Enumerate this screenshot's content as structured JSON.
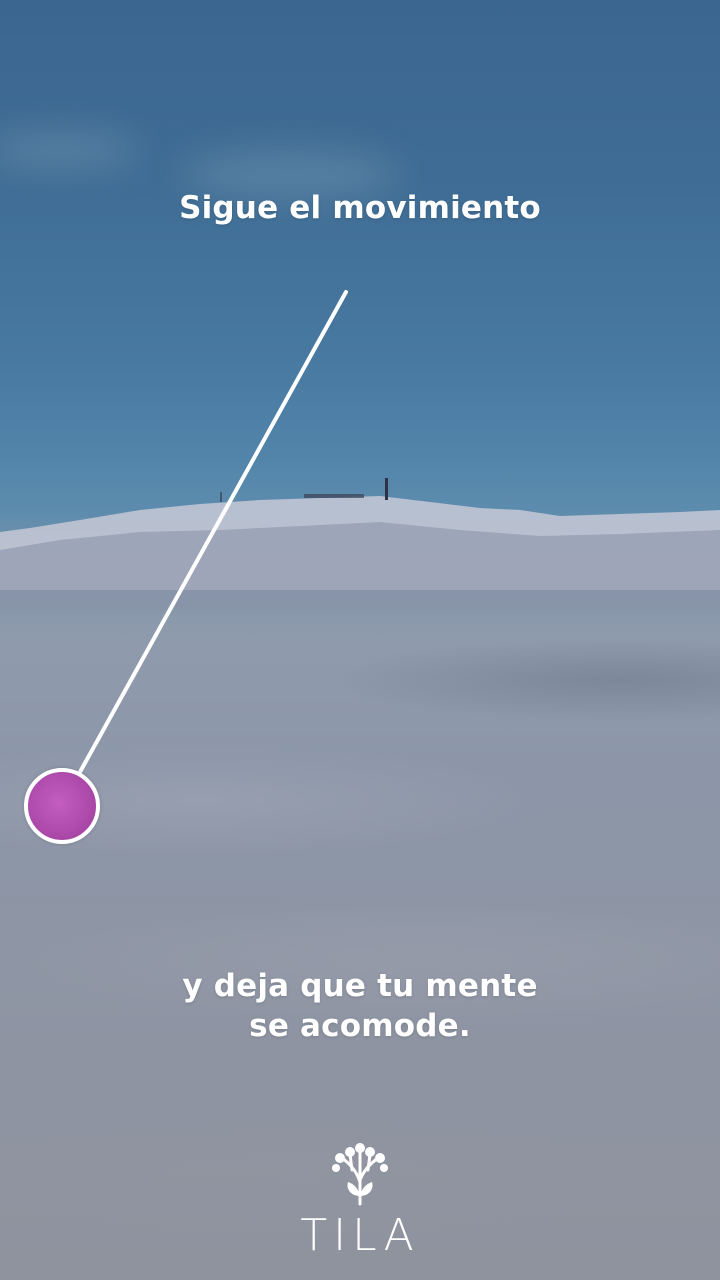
{
  "screen": {
    "top_text": "Sigue el movimiento",
    "bottom_text_line1": "y deja que tu mente",
    "bottom_text_line2": "se acomode."
  },
  "brand": {
    "name": "TILA",
    "logo_icon": "tree-sprout-icon"
  },
  "colors": {
    "ball": "#b04fb0",
    "ball_border": "#ffffff",
    "line": "#ffffff",
    "sky": "#3d6a92",
    "fog": "#8f939e"
  }
}
